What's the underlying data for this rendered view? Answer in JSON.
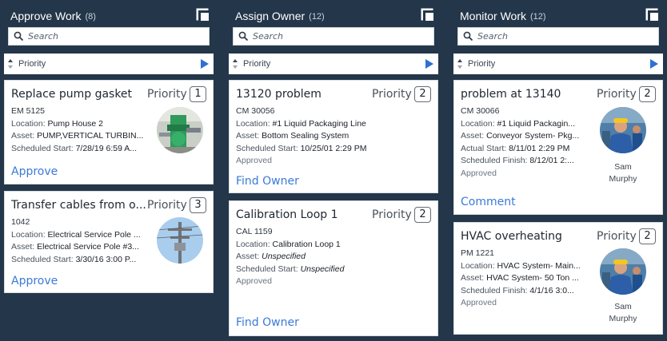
{
  "columns": [
    {
      "title": "Approve Work",
      "count": "(8)",
      "search_placeholder": "Search",
      "sort_label": "Priority",
      "cards": [
        {
          "title": "Replace pump gasket",
          "priority_label": "Priority",
          "priority": "1",
          "id": "EM 5125",
          "line1_key": "Location:",
          "line1_val": "Pump House 2",
          "line2_key": "Asset:",
          "line2_val": "PUMP,VERTICAL TURBIN...",
          "line3_key": "Scheduled Start:",
          "line3_val": "7/28/19 6:59 A...",
          "action": "Approve",
          "thumbnail": "pump-photo"
        },
        {
          "title": "Transfer cables from o...",
          "priority_label": "Priority",
          "priority": "3",
          "id": "1042",
          "line1_key": "Location:",
          "line1_val": "Electrical Service Pole ...",
          "line2_key": "Asset:",
          "line2_val": "Electrical Service Pole #3...",
          "line3_key": "Scheduled Start:",
          "line3_val": "3/30/16 3:00 P...",
          "action": "Approve",
          "thumbnail": "power-pole-photo"
        }
      ]
    },
    {
      "title": "Assign Owner",
      "count": "(12)",
      "search_placeholder": "Search",
      "sort_label": "Priority",
      "cards": [
        {
          "title": "13120 problem",
          "priority_label": "Priority",
          "priority": "2",
          "id": "CM 30056",
          "line1_key": "Location:",
          "line1_val": "#1 Liquid Packaging Line",
          "line2_key": "Asset:",
          "line2_val": "Bottom Sealing System",
          "line3_key": "Scheduled Start:",
          "line3_val": "10/25/01 2:29 PM",
          "status": "Approved",
          "action": "Find Owner"
        },
        {
          "title": "Calibration Loop 1",
          "priority_label": "Priority",
          "priority": "2",
          "id": "CAL 1159",
          "line1_key": "Location:",
          "line1_val": "Calibration Loop 1",
          "line2_key": "Asset:",
          "line2_val": "Unspecified",
          "line3_key": "Scheduled Start:",
          "line3_val": "Unspecified",
          "status": "Approved",
          "action": "Find Owner"
        }
      ]
    },
    {
      "title": "Monitor Work",
      "count": "(12)",
      "search_placeholder": "Search",
      "sort_label": "Priority",
      "cards": [
        {
          "title": "problem at 13140",
          "priority_label": "Priority",
          "priority": "2",
          "id": "CM 30066",
          "line1_key": "Location:",
          "line1_val": "#1 Liquid Packagin...",
          "line2_key": "Asset:",
          "line2_val": "Conveyor System- Pkg...",
          "line3_key": "Actual Start:",
          "line3_val": "8/11/01 2:29 PM",
          "line4_key": "Scheduled Finish:",
          "line4_val": "8/12/01 2:...",
          "status": "Approved",
          "person_first": "Sam",
          "person_last": "Murphy",
          "action": "Comment"
        },
        {
          "title": "HVAC overheating",
          "priority_label": "Priority",
          "priority": "2",
          "id": "PM 1221",
          "line1_key": "Location:",
          "line1_val": "HVAC System- Main...",
          "line2_key": "Asset:",
          "line2_val": "HVAC System- 50 Ton ...",
          "line3_key": "Scheduled Finish:",
          "line3_val": "4/1/16 3:0...",
          "status": "Approved",
          "person_first": "Sam",
          "person_last": "Murphy"
        }
      ]
    }
  ],
  "colors": {
    "background": "#24364a",
    "card": "#ffffff",
    "link": "#3b7ad8",
    "play_arrow": "#2f6fd6"
  }
}
